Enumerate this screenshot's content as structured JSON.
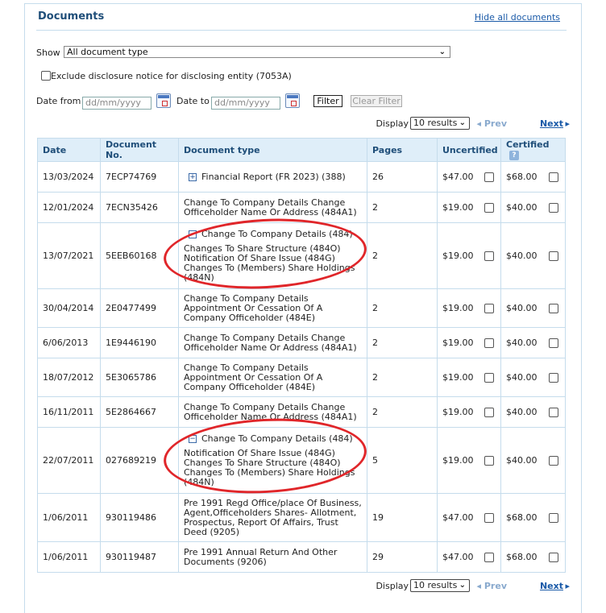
{
  "panel": {
    "title": "Documents",
    "hide_link": "Hide all documents"
  },
  "filters": {
    "show_label": "Show",
    "show_value": "All document type",
    "exclude_label": "Exclude disclosure notice for disclosing entity (7053A)",
    "date_from_label": "Date from",
    "date_to_label": "Date to",
    "date_placeholder": "dd/mm/yyyy",
    "filter_button": "Filter",
    "clear_button": "Clear Filter"
  },
  "pager": {
    "display_label": "Display",
    "results_value": "10 results",
    "prev": "Prev",
    "next": "Next"
  },
  "table": {
    "headers": {
      "date": "Date",
      "docno": "Document No.",
      "type": "Document type",
      "pages": "Pages",
      "uncertified": "Uncertified",
      "certified": "Certified"
    },
    "rows": [
      {
        "date": "13/03/2024",
        "docno": "7ECP74769",
        "type_lines": [
          "Financial Report (FR 2023) (388)"
        ],
        "expander": "+",
        "pages": "26",
        "uncert": "$47.00",
        "cert": "$68.00"
      },
      {
        "date": "12/01/2024",
        "docno": "7ECN35426",
        "type_lines": [
          "Change To Company Details Change Officeholder Name Or Address (484A1)"
        ],
        "expander": "",
        "pages": "2",
        "uncert": "$19.00",
        "cert": "$40.00"
      },
      {
        "date": "13/07/2021",
        "docno": "5EEB60168",
        "type_lines": [
          "Change To Company Details (484)",
          "Changes To Share Structure (484O)",
          "Notification Of Share Issue (484G)",
          "Changes To (Members) Share Holdings (484N)"
        ],
        "expander": "−",
        "pages": "2",
        "uncert": "$19.00",
        "cert": "$40.00"
      },
      {
        "date": "30/04/2014",
        "docno": "2E0477499",
        "type_lines": [
          "Change To Company Details Appointment Or Cessation Of A Company Officeholder (484E)"
        ],
        "expander": "",
        "pages": "2",
        "uncert": "$19.00",
        "cert": "$40.00"
      },
      {
        "date": "6/06/2013",
        "docno": "1E9446190",
        "type_lines": [
          "Change To Company Details Change Officeholder Name Or Address (484A1)"
        ],
        "expander": "",
        "pages": "2",
        "uncert": "$19.00",
        "cert": "$40.00"
      },
      {
        "date": "18/07/2012",
        "docno": "5E3065786",
        "type_lines": [
          "Change To Company Details Appointment Or Cessation Of A Company Officeholder (484E)"
        ],
        "expander": "",
        "pages": "2",
        "uncert": "$19.00",
        "cert": "$40.00"
      },
      {
        "date": "16/11/2011",
        "docno": "5E2864667",
        "type_lines": [
          "Change To Company Details Change Officeholder Name Or Address (484A1)"
        ],
        "expander": "",
        "pages": "2",
        "uncert": "$19.00",
        "cert": "$40.00"
      },
      {
        "date": "22/07/2011",
        "docno": "027689219",
        "type_lines": [
          "Change To Company Details (484)",
          "Notification Of Share Issue (484G)",
          "Changes To Share Structure (484O)",
          "Changes To (Members) Share Holdings (484N)"
        ],
        "expander": "−",
        "pages": "5",
        "uncert": "$19.00",
        "cert": "$40.00"
      },
      {
        "date": "1/06/2011",
        "docno": "930119486",
        "type_lines": [
          "Pre 1991 Regd Office/place Of Business, Agent,Officeholders Shares- Allotment, Prospectus, Report Of Affairs, Trust Deed (9205)"
        ],
        "expander": "",
        "pages": "19",
        "uncert": "$47.00",
        "cert": "$68.00"
      },
      {
        "date": "1/06/2011",
        "docno": "930119487",
        "type_lines": [
          "Pre 1991 Annual Return And Other Documents (9206)"
        ],
        "expander": "",
        "pages": "29",
        "uncert": "$47.00",
        "cert": "$68.00"
      }
    ]
  },
  "annotation": {
    "color": "#e0262a"
  }
}
